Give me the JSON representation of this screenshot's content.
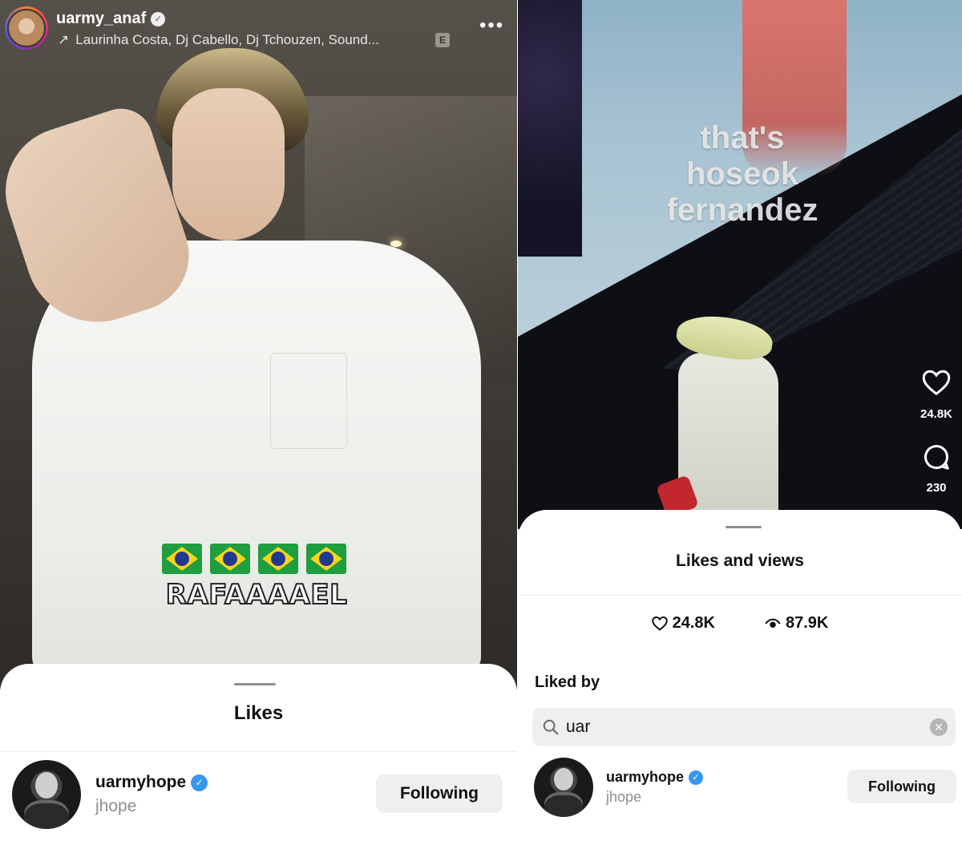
{
  "left": {
    "header": {
      "username": "uarmy_anaf",
      "audio_text": "Laurinha Costa, Dj Cabello, Dj Tchouzen, Sound...",
      "explicit_badge": "E",
      "more_icon": "more-horizontal-icon"
    },
    "video": {
      "caption": "RAFAAAAEL",
      "flag_emojis": [
        "brazil-flag",
        "brazil-flag",
        "brazil-flag",
        "brazil-flag"
      ]
    },
    "sheet": {
      "title": "Likes",
      "user": {
        "username": "uarmyhope",
        "subtitle": "jhope",
        "button": "Following"
      }
    }
  },
  "right": {
    "video": {
      "overlay_text_lines": [
        "that's",
        "hoseok",
        "fernandez"
      ],
      "likes_count": "24.8K",
      "comments_count": "230"
    },
    "sheet": {
      "title": "Likes and views",
      "likes": "24.8K",
      "views": "87.9K",
      "liked_by_label": "Liked by",
      "search_value": "uar",
      "user": {
        "username": "uarmyhope",
        "subtitle": "jhope",
        "button": "Following"
      }
    }
  },
  "colors": {
    "verified_blue": "#3897f0",
    "button_bg": "#efefef",
    "muted_text": "#8e8e8e"
  }
}
